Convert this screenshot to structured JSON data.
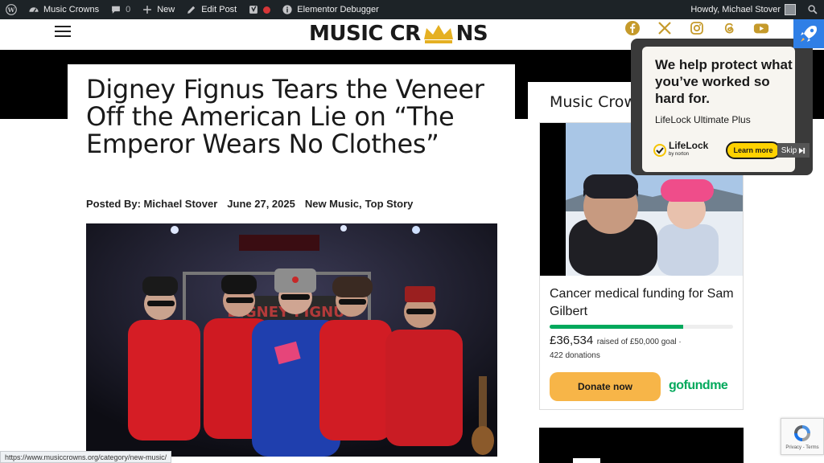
{
  "admin_bar": {
    "site_name": "Music Crowns",
    "comments_count": "0",
    "new_label": "New",
    "edit_label": "Edit Post",
    "debugger_label": "Elementor Debugger",
    "howdy": "Howdy, Michael Stover"
  },
  "header": {
    "logo_text_left": "MUSIC CR",
    "logo_text_right": "NS",
    "socials": [
      "facebook-icon",
      "x-icon",
      "instagram-icon",
      "threads-icon",
      "youtube-icon"
    ]
  },
  "article": {
    "headline": "Digney Fignus Tears the Veneer Off the American Lie on “The Emperor Wears No Clothes”",
    "posted_by": "Posted By: Michael Stover",
    "date": "June 27, 2025",
    "category_1": "New Music",
    "category_sep": ",",
    "category_2": "Top Story",
    "banner_text": "DIGNEY FIGNUS"
  },
  "sidebar": {
    "heading": "Music Crowns",
    "fundraiser": {
      "title": "Cancer medical funding for Sam Gilbert",
      "raised": "£36,534",
      "goal_text": "raised of £50,000 goal ·",
      "progress": 0.73,
      "donations": "422 donations",
      "donate_label": "Donate now",
      "brand": "gofundme"
    }
  },
  "ad": {
    "headline": "We help protect what you’ve worked so hard for.",
    "product": "LifeLock Ultimate Plus",
    "brand": "LifeLock",
    "brand_sub": "by norton",
    "cta": "Learn more",
    "skip": "Skip"
  },
  "status_url": "https://www.musiccrowns.org/category/new-music/",
  "recaptcha": {
    "links": "Privacy - Terms"
  },
  "colors": {
    "admin_bar_bg": "#1d2327",
    "gofundme_green": "#02a95c",
    "donate_button": "#f7b548",
    "logo_gold": "#e5b022",
    "ad_cta": "#ffd200"
  }
}
